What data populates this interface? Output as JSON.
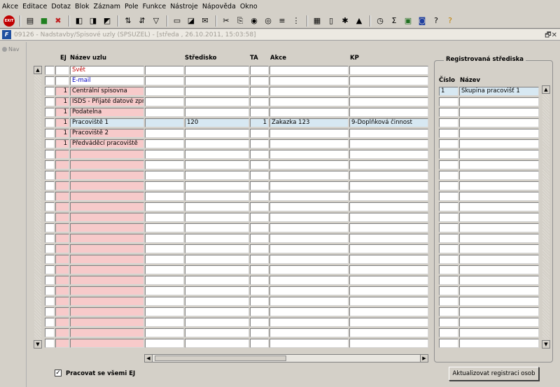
{
  "menu": [
    "Akce",
    "Editace",
    "Dotaz",
    "Blok",
    "Záznam",
    "Pole",
    "Funkce",
    "Nástroje",
    "Nápověda",
    "Okno"
  ],
  "toolbar": {
    "exit_label": "EXIT"
  },
  "window": {
    "title": "09126 - Nadstavby/Spisové uzly (SPSUZEL) - [středa , 26.10.2011, 15:03:58]",
    "controls": "🗗✕"
  },
  "nav": {
    "label": "Nav"
  },
  "grid": {
    "headers": {
      "ej": "EJ",
      "name": "Název uzlu",
      "center": "Středisko",
      "ta": "TA",
      "action": "Akce",
      "kp": "KP"
    },
    "rows": [
      {
        "ej": "",
        "name": "Svět",
        "center": "",
        "ta": "",
        "action": "",
        "kp": "",
        "color": "red"
      },
      {
        "ej": "",
        "name": "E-mail",
        "center": "",
        "ta": "",
        "action": "",
        "kp": "",
        "color": "blue"
      },
      {
        "ej": "1",
        "name": "Centrální spisovna",
        "center": "",
        "ta": "",
        "action": "",
        "kp": ""
      },
      {
        "ej": "1",
        "name": "ISDS - Přijaté datové zpráv",
        "center": "",
        "ta": "",
        "action": "",
        "kp": ""
      },
      {
        "ej": "1",
        "name": "Podatelna",
        "center": "",
        "ta": "",
        "action": "",
        "kp": ""
      },
      {
        "ej": "1",
        "name": "Pracoviště 1",
        "center": "120",
        "ta": "1",
        "action": "Zakazka 123",
        "kp": "9-Doplňková činnost",
        "selected": true
      },
      {
        "ej": "1",
        "name": "Pracoviště 2",
        "center": "",
        "ta": "",
        "action": "",
        "kp": ""
      },
      {
        "ej": "1",
        "name": "Předváděcí pracoviště",
        "center": "",
        "ta": "",
        "action": "",
        "kp": ""
      }
    ]
  },
  "registered": {
    "title": "Registrovaná střediska",
    "headers": {
      "num": "Číslo",
      "name": "Název"
    },
    "rows": [
      {
        "num": "1",
        "name": "Skupina pracovišť 1"
      }
    ]
  },
  "footer": {
    "checkbox_label": "Pracovat se všemi EJ",
    "checkbox_checked": "✓",
    "update_button": "Aktualizovat registraci osob"
  }
}
